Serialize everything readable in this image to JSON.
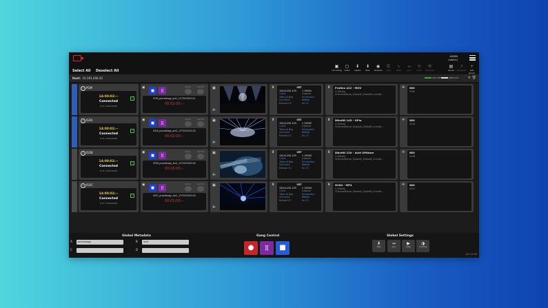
{
  "header": {
    "admin_name": "ADMIN",
    "admin_role": "(admin)",
    "select_all": "Select All",
    "deselect_all": "Deselect All"
  },
  "toolbar": [
    {
      "label": "recording",
      "icon": "recording-icon",
      "glyph": "▣",
      "state": "normal"
    },
    {
      "label": "video",
      "icon": "video-icon",
      "glyph": "▢",
      "state": "normal"
    },
    {
      "label": "inputs",
      "icon": "inputs-icon",
      "glyph": "⬇",
      "state": "normal"
    },
    {
      "label": "files",
      "icon": "files-icon",
      "glyph": "⬇",
      "state": "normal"
    },
    {
      "label": "streams",
      "icon": "streams-icon",
      "glyph": "◉",
      "state": "normal"
    },
    {
      "label": "clips",
      "icon": "clips-icon",
      "glyph": "☰",
      "state": "dim"
    },
    {
      "label": "stats",
      "icon": "stats-icon",
      "glyph": "∿",
      "state": "dim"
    },
    {
      "label": "sync",
      "icon": "sync-icon",
      "glyph": "↔",
      "state": "dim"
    },
    {
      "label": "loop",
      "icon": "loop-icon",
      "glyph": "↻",
      "state": "dim"
    },
    {
      "label": "Spanner",
      "icon": "spanner-icon",
      "glyph": "⚒",
      "state": "dim"
    },
    {
      "label": "server",
      "icon": "server-icon",
      "glyph": "▤",
      "state": "normal"
    },
    {
      "label": "transport",
      "icon": "transport-icon",
      "glyph": "↗",
      "state": "dim"
    },
    {
      "label": "add server",
      "icon": "add-icon",
      "glyph": "+",
      "state": "green"
    }
  ],
  "host": {
    "label": "Host:",
    "ip": "10.191.240.43",
    "cpu": "CPU 38%",
    "mem": "MEM 23%"
  },
  "channels": [
    {
      "name": "PGM",
      "stripe": "#2e5fb7",
      "timecode": "14:00:02:--",
      "status": "Connected",
      "sub": "H.VC 1920x1080",
      "file": "PGM_proceblogy_act1_13720230G141",
      "rec_tc": "00:02:00:--",
      "srt_title": "SRT",
      "srt_ip": "134.6.232.129",
      "srt_port": "1 19001",
      "srt_caller": "Caller",
      "srt_listener": "Listener",
      "srt_tos": "Time of Day",
      "srt_embedded": "Embedded",
      "srt_standard": "Standard",
      "srt_native": "Native",
      "srt_extcc": "Extract CC",
      "srt_nocc": "No CC",
      "codec": "ProRes 422 - MOV",
      "codec_path": "C:\\Media",
      "codec_file": "ChannelName_GlobalA_GlobalB_mm/dd...",
      "ndi": "NDI",
      "ndi_src": "PGM",
      "thumb": "concert"
    },
    {
      "name": "ISOA",
      "stripe": "#2e5fb7",
      "timecode": "14:00:02:--",
      "status": "Connected",
      "sub": "H.VC 1920x1080",
      "file": "ISOA_proceblogy_act1_13720230G142",
      "rec_tc": "00:02:00:--",
      "srt_title": "SRT",
      "srt_ip": "134.6.232.129",
      "srt_port": "1 19002",
      "srt_caller": "Caller",
      "srt_listener": "Listener",
      "srt_tos": "Time of Day",
      "srt_embedded": "Embedded",
      "srt_standard": "Standard",
      "srt_native": "Native",
      "srt_extcc": "Extract CC",
      "srt_nocc": "No CC",
      "codec": "DNxHD 145 - OPla",
      "codec_path": "C:\\Media",
      "codec_file": "ChannelName_GlobalA_GlobalB_mm/dd...",
      "ndi": "NDI",
      "ndi_src": "ISOA",
      "thumb": "lights"
    },
    {
      "name": "ISOB",
      "stripe": "#4a4a4a",
      "timecode": "14:00:02:--",
      "status": "Connected",
      "sub": "H.VC 1920x1080",
      "file": "ISOB_proceblogy_act1_13720230G142",
      "rec_tc": "00:02:00:--",
      "srt_title": "SRT",
      "srt_ip": "134.6.232.129",
      "srt_port": "1 19003",
      "srt_caller": "Caller",
      "srt_listener": "Listener",
      "srt_tos": "Time of Day",
      "srt_embedded": "Embedded",
      "srt_standard": "Standard",
      "srt_native": "Native",
      "srt_extcc": "Extract CC",
      "srt_nocc": "No CC",
      "codec": "DNxHD 220 - Avid OPAtom",
      "codec_path": "C:\\Media",
      "codec_file": "ChannelName_GlobalA_GlobalB_mm/dd...",
      "ndi": "NDI",
      "ndi_src": "ISOB",
      "thumb": "guitar"
    },
    {
      "name": "ISOC",
      "stripe": "#4a4a4a",
      "timecode": "14:00:02:--",
      "status": "Connected",
      "sub": "H.VC 1920x1080",
      "file": "ISOC_proceblogy_act1_13720230G142",
      "rec_tc": "00:02:00:--",
      "srt_title": "SRT",
      "srt_ip": "134.6.232.129",
      "srt_port": "1 19004",
      "srt_caller": "Caller",
      "srt_listener": "Listener",
      "srt_tos": "Time of Day",
      "srt_embedded": "Embedded",
      "srt_standard": "Standard",
      "srt_native": "Native",
      "srt_extcc": "Extract CC",
      "srt_nocc": "No CC",
      "codec": "H264 - MP4",
      "codec_path": "C:\\Media",
      "codec_file": "ChannelName_GlobalA_GlobalB_mm/dd...",
      "ndi": "NDI",
      "ndi_src": "ISOC",
      "thumb": "laser"
    }
  ],
  "buttons": {
    "record_glyph": "●",
    "stop_glyph": "■",
    "marker_glyph": "][",
    "upload_lbl": "Upload",
    "split_lbl": "Split file"
  },
  "global_metadata": {
    "title": "Global Metadata",
    "a_label": "A",
    "a_value": "proceology",
    "b_label": "B",
    "b_value": "act1",
    "c_label": "C",
    "c_value": "",
    "d_label": "D",
    "d_value": ""
  },
  "gang": {
    "title": "Gang Control"
  },
  "global_settings": {
    "title": "Global Settings",
    "items": [
      {
        "label": "files",
        "glyph": "⬇",
        "icon": "files-icon"
      },
      {
        "label": "sync",
        "glyph": "↔",
        "icon": "sync-icon"
      },
      {
        "label": "video",
        "glyph": "▶",
        "icon": "video-icon"
      },
      {
        "label": "clocking",
        "glyph": "◑",
        "icon": "clocking-icon"
      }
    ]
  },
  "version": "v2.1.0.32",
  "colors": {
    "record": "#c5262c",
    "marker": "#7d2aa2",
    "stop": "#2a5bd4",
    "stop_blue": "#1f3fd4"
  }
}
